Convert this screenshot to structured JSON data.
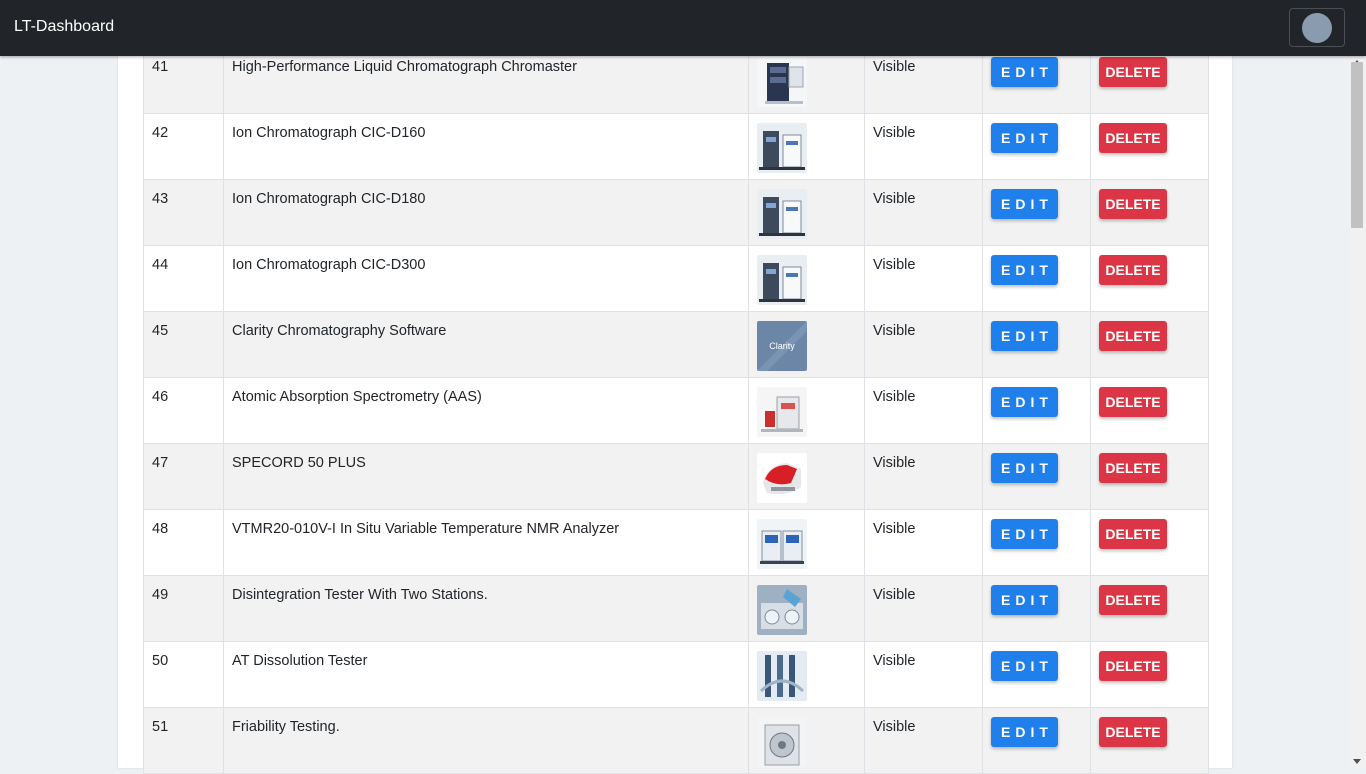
{
  "app": {
    "brand": "LT-Dashboard"
  },
  "colors": {
    "navbar": "#212529",
    "edit_button": "#1f80ec",
    "delete_button": "#dc3545"
  },
  "actions": {
    "edit_label": "EDIT",
    "delete_label": "DELETE"
  },
  "rows": [
    {
      "id": "41",
      "name": "High-Performance Liquid Chromatograph Chromaster",
      "status": "Visible",
      "thumb": "hplc-instrument-image"
    },
    {
      "id": "42",
      "name": "Ion Chromatograph CIC-D160",
      "status": "Visible",
      "thumb": "ion-chromatograph-image"
    },
    {
      "id": "43",
      "name": "Ion Chromatograph CIC-D180",
      "status": "Visible",
      "thumb": "ion-chromatograph-image"
    },
    {
      "id": "44",
      "name": "Ion Chromatograph CIC-D300",
      "status": "Visible",
      "thumb": "ion-chromatograph-image"
    },
    {
      "id": "45",
      "name": "Clarity Chromatography Software",
      "status": "Visible",
      "thumb": "clarity-logo-image",
      "thumb_text": "Clarity"
    },
    {
      "id": "46",
      "name": "Atomic Absorption Spectrometry (AAS)",
      "status": "Visible",
      "thumb": "spectrometer-image"
    },
    {
      "id": "47",
      "name": "SPECORD 50 PLUS",
      "status": "Visible",
      "thumb": "spectrophotometer-image"
    },
    {
      "id": "48",
      "name": "VTMR20-010V-I In Situ Variable Temperature NMR Analyzer",
      "status": "Visible",
      "thumb": "nmr-analyzer-image"
    },
    {
      "id": "49",
      "name": "Disintegration Tester With Two Stations.",
      "status": "Visible",
      "thumb": "disintegration-tester-image"
    },
    {
      "id": "50",
      "name": "AT Dissolution Tester",
      "status": "Visible",
      "thumb": "dissolution-tester-image"
    },
    {
      "id": "51",
      "name": "Friability Testing.",
      "status": "Visible",
      "thumb": "friability-tester-image"
    }
  ]
}
